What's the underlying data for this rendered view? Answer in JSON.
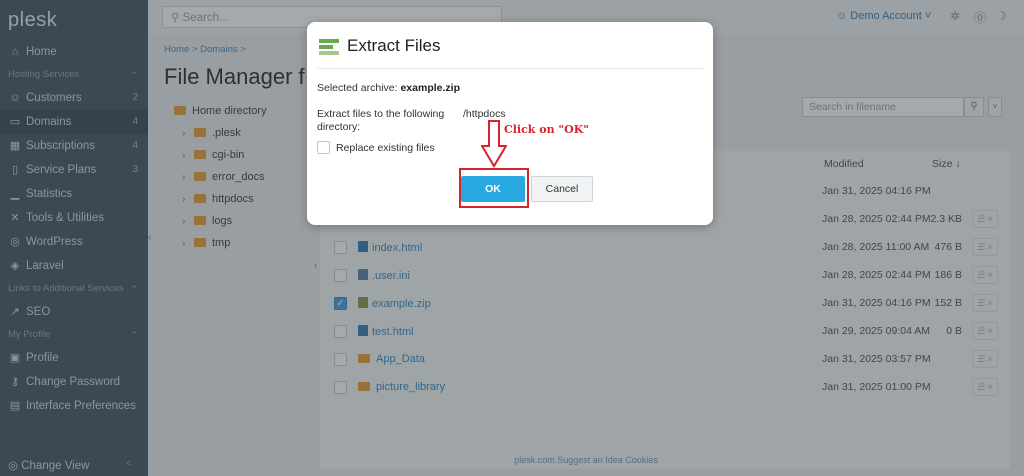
{
  "sidebar": {
    "logo": "plesk",
    "items": [
      {
        "label": "Home",
        "icon": "home-icon",
        "glyph": "⌂"
      },
      {
        "label": "Customers",
        "icon": "user-icon",
        "glyph": "☺",
        "count": "2"
      },
      {
        "label": "Domains",
        "icon": "monitor-icon",
        "glyph": "▭",
        "count": "4"
      },
      {
        "label": "Subscriptions",
        "icon": "grid-icon",
        "glyph": "▦",
        "count": "4"
      },
      {
        "label": "Service Plans",
        "icon": "plan-icon",
        "glyph": "▯",
        "count": "3"
      },
      {
        "label": "Statistics",
        "icon": "chart-icon",
        "glyph": "▁"
      },
      {
        "label": "Tools & Utilities",
        "icon": "tools-icon",
        "glyph": "✕"
      },
      {
        "label": "WordPress",
        "icon": "wordpress-icon",
        "glyph": "◎"
      },
      {
        "label": "Laravel",
        "icon": "laravel-icon",
        "glyph": "◈"
      },
      {
        "label": "SEO",
        "icon": "seo-icon",
        "glyph": "↗"
      },
      {
        "label": "Profile",
        "icon": "profile-icon",
        "glyph": "▣"
      },
      {
        "label": "Change Password",
        "icon": "key-icon",
        "glyph": "⚷"
      },
      {
        "label": "Interface Preferences",
        "icon": "preferences-icon",
        "glyph": "▤"
      }
    ],
    "sections": {
      "hosting": "Hosting Services",
      "links": "Links to Additional Services",
      "profile": "My Profile"
    },
    "change_view": "Change View"
  },
  "topbar": {
    "search_placeholder": "Search...",
    "account": "Demo Account"
  },
  "main": {
    "breadcrumb": "Home > Domains >",
    "title": "File Manager f",
    "tree": {
      "root": "Home directory",
      "folders": [
        ".plesk",
        "cgi-bin",
        "error_docs",
        "httpdocs",
        "logs",
        "tmp"
      ]
    },
    "search_filename_placeholder": "Search in filename",
    "columns": {
      "modified": "Modified",
      "size": "Size"
    },
    "rows": [
      {
        "name": "",
        "date": "Jan 31, 2025 04:16 PM",
        "size": ""
      },
      {
        "name": "",
        "date": "Jan 28, 2025 02:44 PM",
        "size": "2.3 KB"
      },
      {
        "name": "index.html",
        "date": "Jan 28, 2025 11:00 AM",
        "size": "476 B"
      },
      {
        "name": ".user.ini",
        "date": "Jan 28, 2025 02:44 PM",
        "size": "186 B"
      },
      {
        "name": "example.zip",
        "date": "Jan 31, 2025 04:16 PM",
        "size": "152 B",
        "checked": true
      },
      {
        "name": "test.html",
        "date": "Jan 29, 2025 09:04 AM",
        "size": "0 B"
      },
      {
        "name": "App_Data",
        "date": "Jan 31, 2025 03:57 PM",
        "size": ""
      },
      {
        "name": "picture_library",
        "date": "Jan 31, 2025 01:00 PM",
        "size": ""
      }
    ]
  },
  "footer": "plesk.com   Suggest an Idea   Cookies",
  "modal": {
    "title": "Extract Files",
    "archive_label": "Selected archive: ",
    "archive_name": "example.zip",
    "extract_label": "Extract files to the following directory:",
    "extract_value": "/httpdocs",
    "replace_label": "Replace existing files",
    "ok_label": "OK",
    "cancel_label": "Cancel"
  },
  "annotation": {
    "text": "Click on \"OK\"",
    "color": "#d8232a"
  },
  "colors": {
    "sidebar": "#4a5965",
    "ok_button": "#28a8e0",
    "annotation": "#d8232a"
  }
}
